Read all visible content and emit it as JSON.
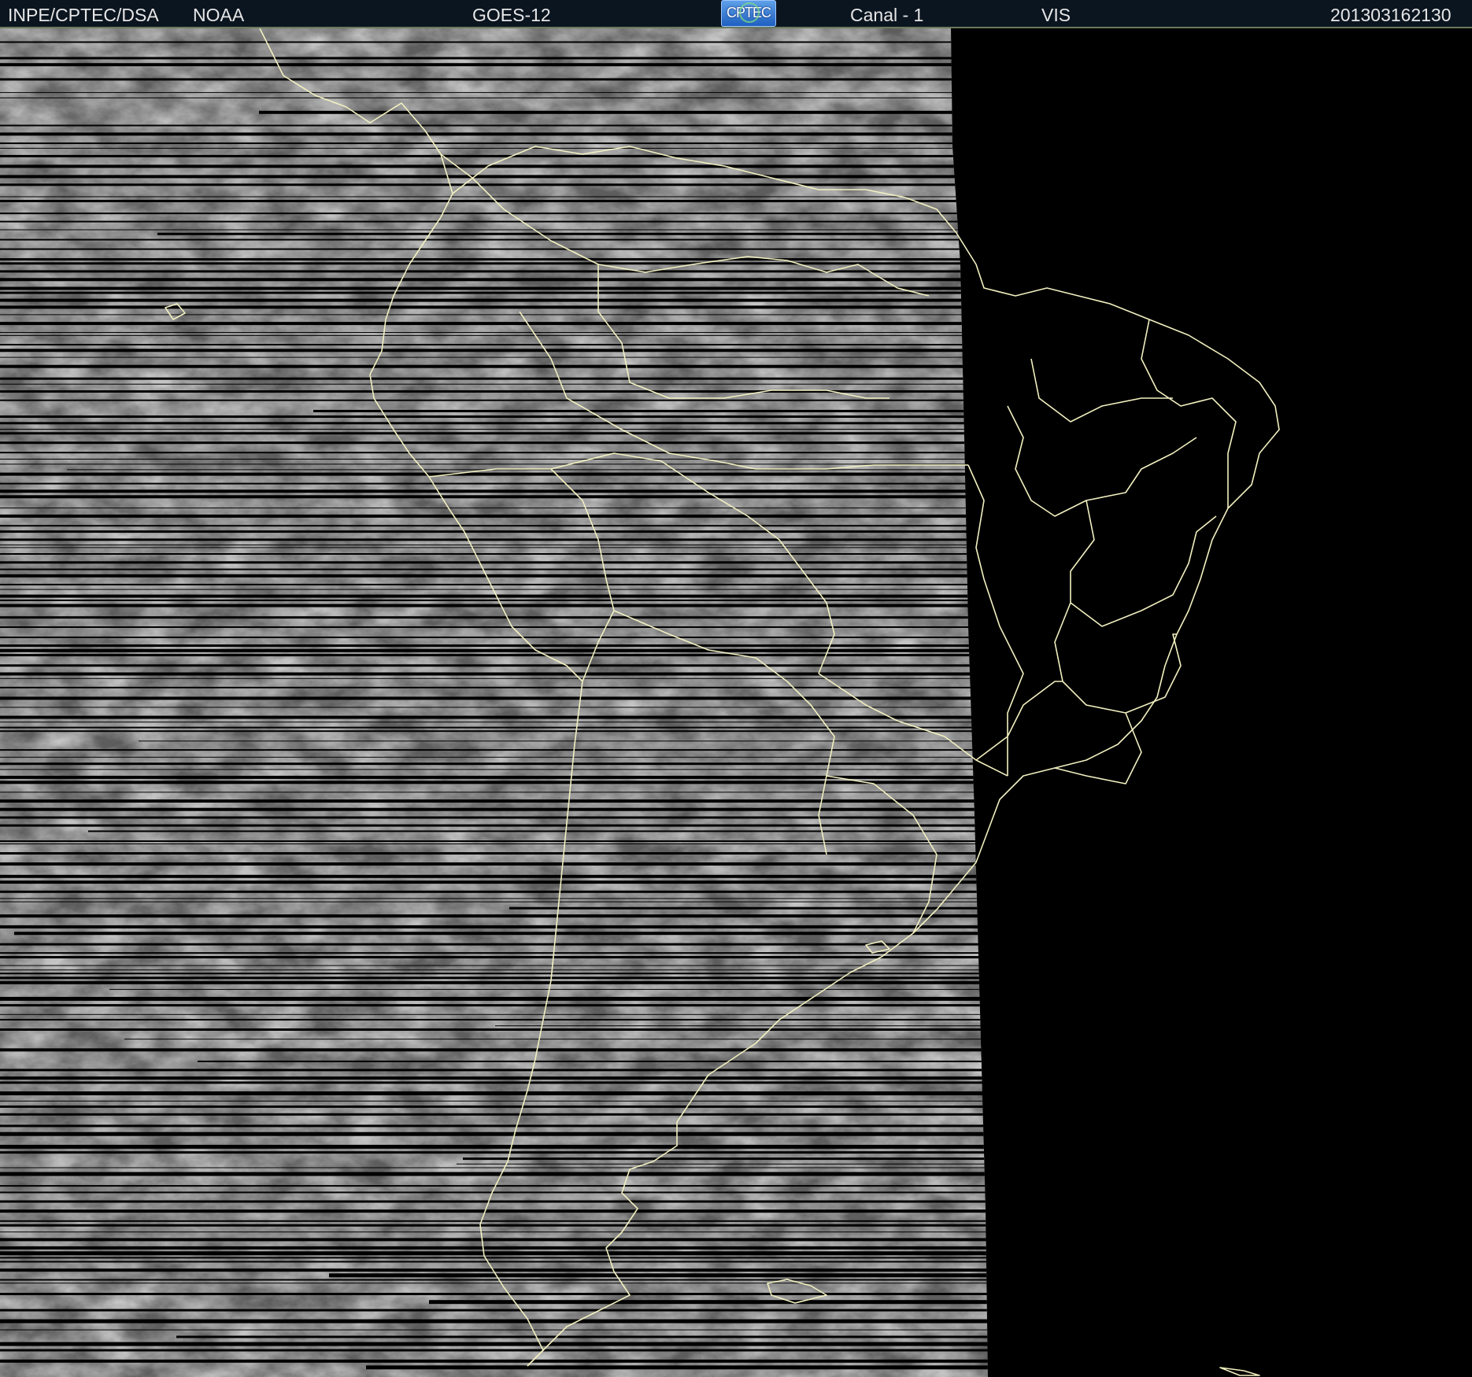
{
  "header": {
    "org": "INPE/CPTEC/DSA",
    "agency": "NOAA",
    "satellite": "GOES-12",
    "logo_text": "CPTEC",
    "channel": "Canal - 1",
    "band": "VIS",
    "timestamp": "201303162130"
  },
  "colors": {
    "header_bg": "#0b1520",
    "header_text": "#e6e6e6",
    "coastline": "#f2f0c0",
    "background": "#000000"
  },
  "icons": {
    "logo": "cptec-logo-icon"
  }
}
